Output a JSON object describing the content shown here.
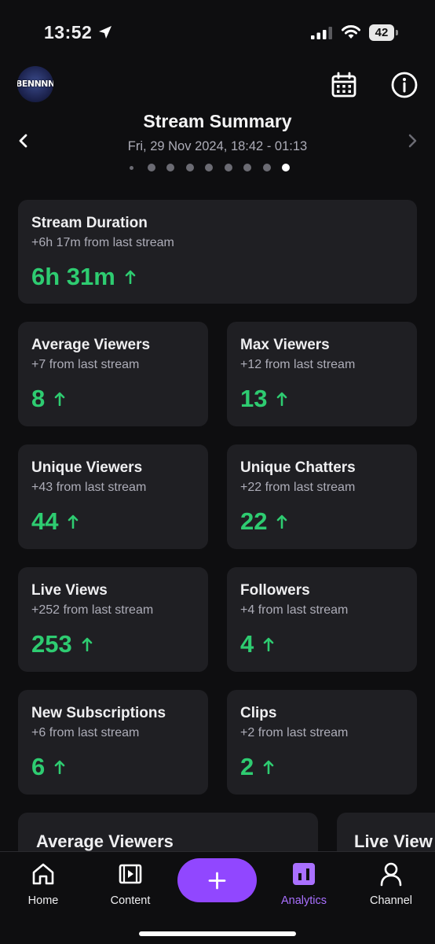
{
  "status_bar": {
    "time": "13:52",
    "battery": "42"
  },
  "header": {
    "avatar_text": "BENNNNNI",
    "title": "Stream Summary",
    "subtitle": "Fri, 29 Nov 2024, 18:42 - 01:13",
    "page_count": 9,
    "active_page": 9
  },
  "stats": [
    {
      "title": "Stream Duration",
      "delta": "+6h 17m from last stream",
      "value": "6h 31m",
      "trend": "up"
    },
    {
      "title": "Average Viewers",
      "delta": "+7 from last stream",
      "value": "8",
      "trend": "up"
    },
    {
      "title": "Max Viewers",
      "delta": "+12 from last stream",
      "value": "13",
      "trend": "up"
    },
    {
      "title": "Unique Viewers",
      "delta": "+43 from last stream",
      "value": "44",
      "trend": "up"
    },
    {
      "title": "Unique Chatters",
      "delta": "+22 from last stream",
      "value": "22",
      "trend": "up"
    },
    {
      "title": "Live Views",
      "delta": "+252 from last stream",
      "value": "253",
      "trend": "up"
    },
    {
      "title": "Followers",
      "delta": "+4 from last stream",
      "value": "4",
      "trend": "up"
    },
    {
      "title": "New Subscriptions",
      "delta": "+6 from last stream",
      "value": "6",
      "trend": "up"
    },
    {
      "title": "Clips",
      "delta": "+2 from last stream",
      "value": "2",
      "trend": "up"
    }
  ],
  "chart_previews": [
    {
      "title": "Average Viewers"
    },
    {
      "title": "Live View"
    }
  ],
  "nav": {
    "items": [
      {
        "label": "Home",
        "icon": "home-icon"
      },
      {
        "label": "Content",
        "icon": "content-icon"
      },
      {
        "label": "Analytics",
        "icon": "analytics-icon",
        "active": true
      },
      {
        "label": "Channel",
        "icon": "person-icon"
      }
    ],
    "create_icon": "plus-icon"
  },
  "colors": {
    "background": "#0e0e10",
    "card": "#1f1f23",
    "positive": "#2ecc71",
    "accent": "#9147ff",
    "active_nav": "#a970ff"
  }
}
